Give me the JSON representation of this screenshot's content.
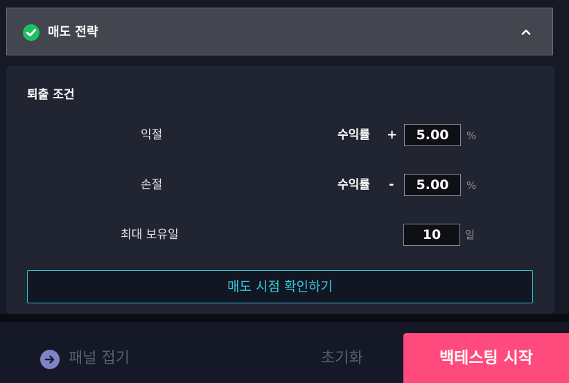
{
  "header": {
    "title": "매도 전략",
    "icon": "check-circle",
    "chevron": "chevron-up"
  },
  "exit_conditions": {
    "title": "퇴출 조건",
    "take_profit": {
      "label": "익절",
      "metric": "수익률",
      "sign": "+",
      "value": "5.00",
      "unit": "%"
    },
    "stop_loss": {
      "label": "손절",
      "metric": "수익률",
      "sign": "-",
      "value": "5.00",
      "unit": "%"
    },
    "max_holding": {
      "label": "최대 보유일",
      "value": "10",
      "unit": "일"
    },
    "confirm_button": "매도 시점 확인하기"
  },
  "footer": {
    "collapse_label": "패널 접기",
    "reset_label": "초기화",
    "start_label": "백테스팅 시작"
  },
  "colors": {
    "accent_green": "#1fc05f",
    "accent_cyan": "#36c8da",
    "accent_pink": "#ff4a7d",
    "accent_purple": "#7f84c8"
  }
}
